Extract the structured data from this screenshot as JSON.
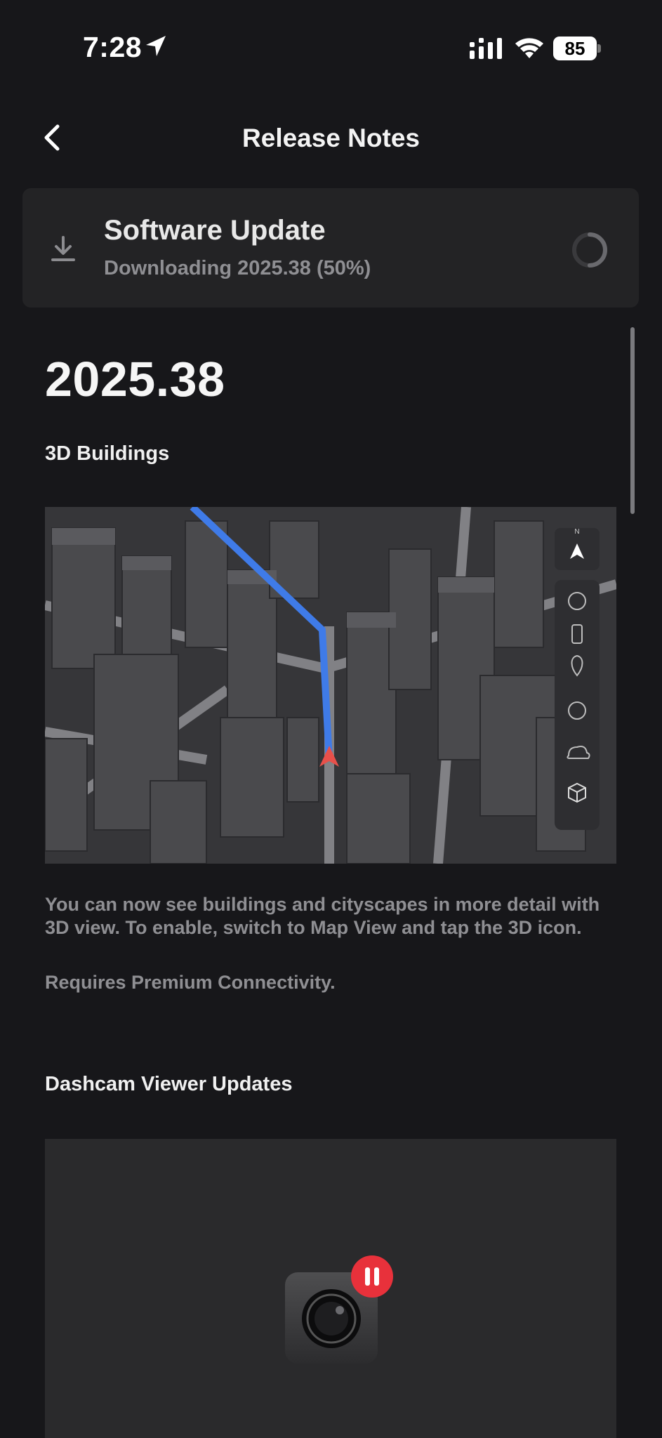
{
  "status_bar": {
    "time": "7:28",
    "battery": "85"
  },
  "header": {
    "title": "Release Notes"
  },
  "update_card": {
    "title": "Software Update",
    "status": "Downloading 2025.38 (50%)",
    "progress": 0.5
  },
  "release": {
    "version": "2025.38",
    "sections": [
      {
        "title": "3D Buildings",
        "body": "You can now see buildings and cityscapes in more detail with 3D view. To enable, switch to Map View and tap the 3D icon.",
        "requirement": "Requires Premium Connectivity."
      },
      {
        "title": "Dashcam Viewer Updates"
      }
    ]
  },
  "map_controls": {
    "compass_label": "N",
    "icons": [
      "navigate-arrow-icon",
      "globe-icon",
      "traffic-light-icon",
      "location-pin-icon",
      "charging-bolt-icon",
      "weather-cloud-icon",
      "3d-cube-icon"
    ]
  },
  "colors": {
    "background": "#17171a",
    "card": "#232325",
    "route": "#3f7be8",
    "pause_badge": "#e8313b"
  }
}
